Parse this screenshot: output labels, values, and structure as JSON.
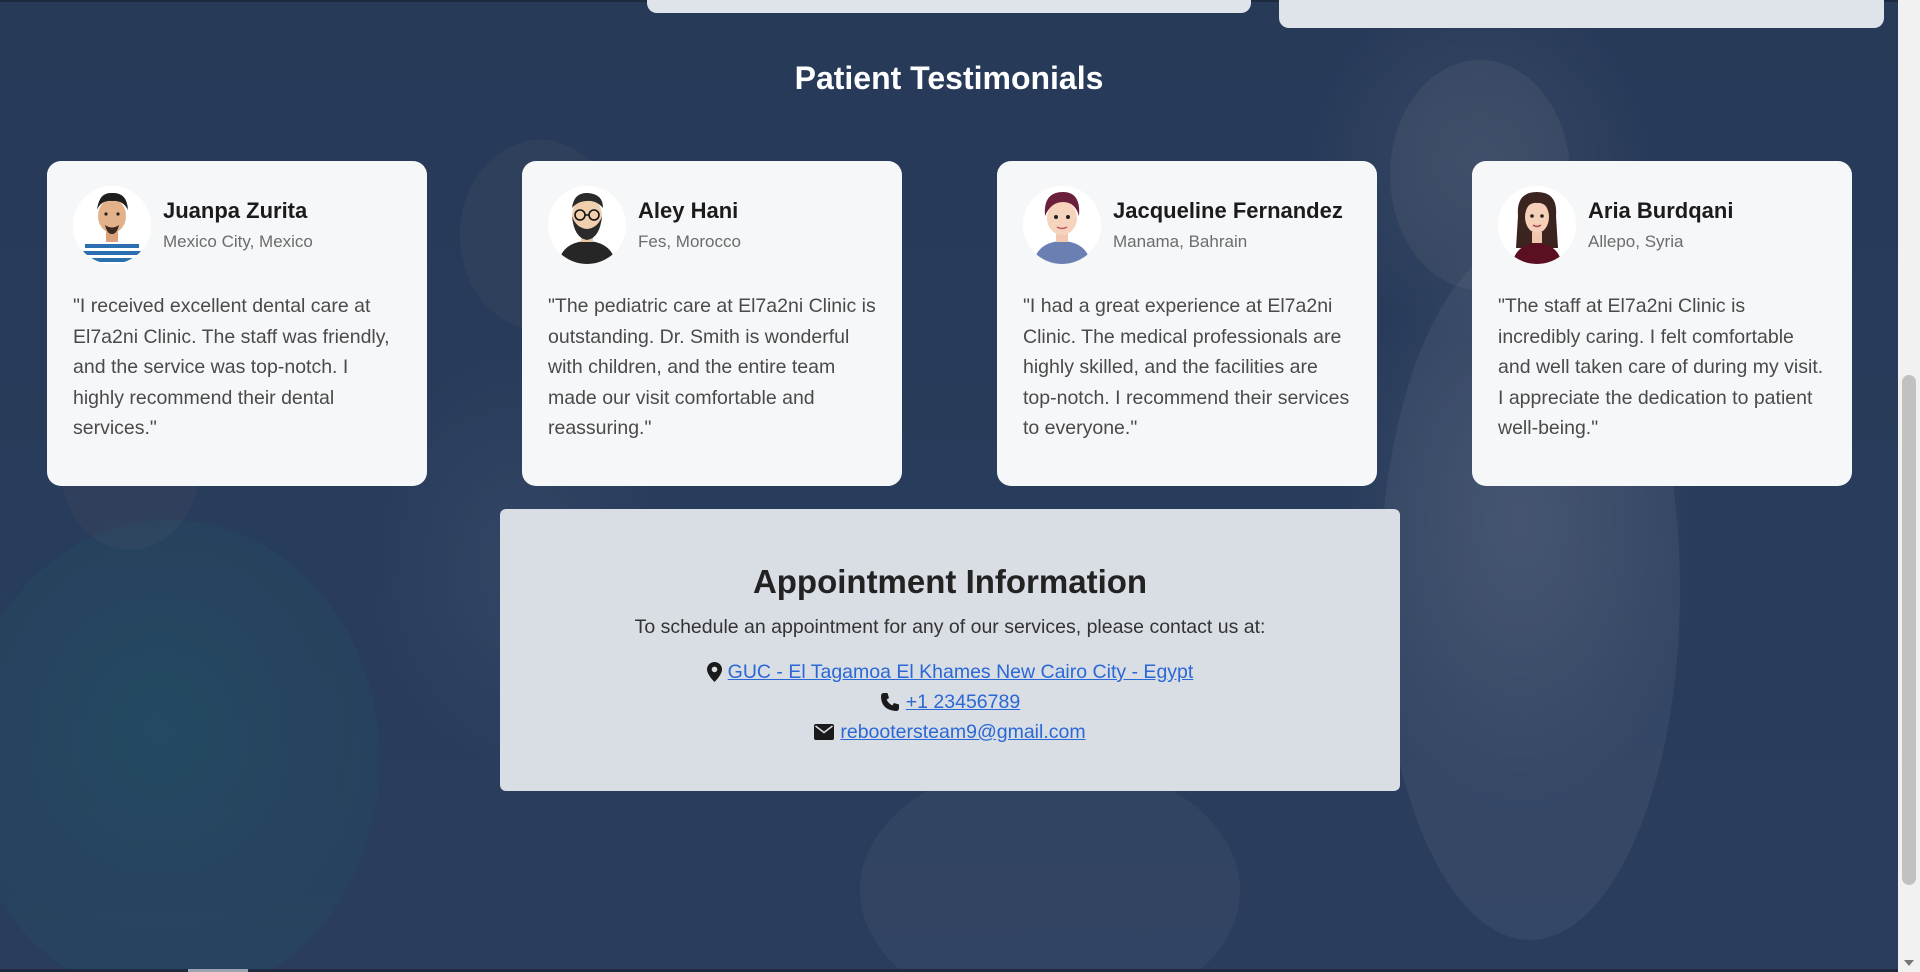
{
  "testimonials": {
    "title": "Patient Testimonials",
    "cards": [
      {
        "name": "Juanpa Zurita",
        "location": "Mexico City, Mexico",
        "quote": "\"I received excellent dental care at El7a2ni Clinic. The staff was friendly, and the service was top-notch. I highly recommend their dental services.\"",
        "avatar_icon": "man-striped-shirt-avatar-icon"
      },
      {
        "name": "Aley Hani",
        "location": "Fes, Morocco",
        "quote": "\"The pediatric care at El7a2ni Clinic is outstanding. Dr. Smith is wonderful with children, and the entire team made our visit comfortable and reassuring.\"",
        "avatar_icon": "bearded-man-glasses-avatar-icon"
      },
      {
        "name": "Jacqueline Fernandez",
        "location": "Manama, Bahrain",
        "quote": "\"I had a great experience at El7a2ni Clinic. The medical professionals are highly skilled, and the facilities are top-notch. I recommend their services to everyone.\"",
        "avatar_icon": "short-hair-person-avatar-icon"
      },
      {
        "name": "Aria Burdqani",
        "location": "Allepo, Syria",
        "quote": "\"The staff at El7a2ni Clinic is incredibly caring. I felt comfortable and well taken care of during my visit. I appreciate the dedication to patient well-being.\"",
        "avatar_icon": "woman-long-hair-avatar-icon"
      }
    ]
  },
  "appointment": {
    "title": "Appointment Information",
    "subtitle": "To schedule an appointment for any of our services, please contact us at:",
    "address": "GUC - El Tagamoa El Khames New Cairo City - Egypt",
    "phone": "+1 23456789",
    "email": "rebootersteam9@gmail.com"
  },
  "colors": {
    "card_background": "#f6f7f9",
    "panel_background": "#d9dde4",
    "link": "#2a68d6",
    "page_overlay": "#30425f"
  }
}
